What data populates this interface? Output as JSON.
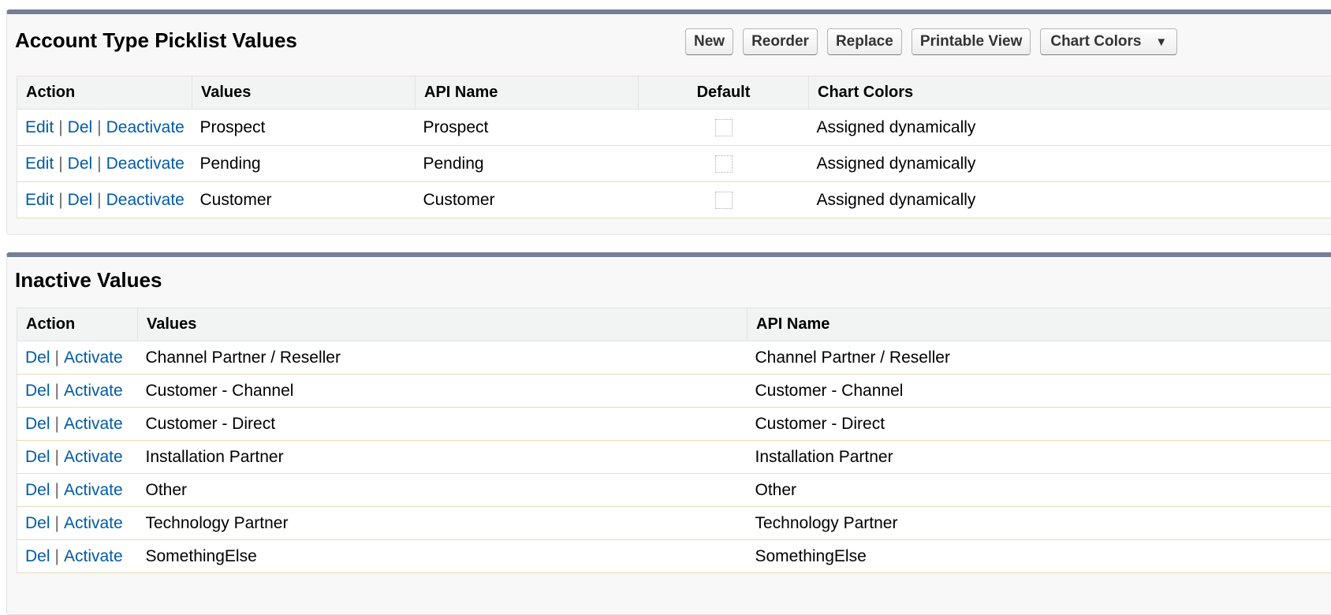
{
  "active": {
    "title": "Account Type Picklist Values",
    "buttons": {
      "new": "New",
      "reorder": "Reorder",
      "replace": "Replace",
      "printable": "Printable View",
      "chart_colors": "Chart Colors"
    },
    "columns": {
      "action": "Action",
      "values": "Values",
      "api_name": "API Name",
      "default": "Default",
      "chart_colors": "Chart Colors"
    },
    "action_labels": {
      "edit": "Edit",
      "del": "Del",
      "deactivate": "Deactivate"
    },
    "rows": [
      {
        "value": "Prospect",
        "api_name": "Prospect",
        "default": false,
        "chart_color": "Assigned dynamically"
      },
      {
        "value": "Pending",
        "api_name": "Pending",
        "default": false,
        "chart_color": "Assigned dynamically"
      },
      {
        "value": "Customer",
        "api_name": "Customer",
        "default": false,
        "chart_color": "Assigned dynamically"
      }
    ]
  },
  "inactive": {
    "title": "Inactive Values",
    "columns": {
      "action": "Action",
      "values": "Values",
      "api_name": "API Name"
    },
    "action_labels": {
      "del": "Del",
      "activate": "Activate"
    },
    "rows": [
      {
        "value": "Channel Partner / Reseller",
        "api_name": "Channel Partner / Reseller"
      },
      {
        "value": "Customer - Channel",
        "api_name": "Customer - Channel"
      },
      {
        "value": "Customer - Direct",
        "api_name": "Customer - Direct"
      },
      {
        "value": "Installation Partner",
        "api_name": "Installation Partner"
      },
      {
        "value": "Other",
        "api_name": "Other"
      },
      {
        "value": "Technology Partner",
        "api_name": "Technology Partner"
      },
      {
        "value": "SomethingElse",
        "api_name": "SomethingElse"
      }
    ]
  },
  "icons": {
    "dropdown": "caret-down-icon",
    "checkbox": "checkbox-icon"
  },
  "colors": {
    "link": "#015ba7",
    "panel_border": "#747e96",
    "header_bg": "#f2f3f3"
  }
}
